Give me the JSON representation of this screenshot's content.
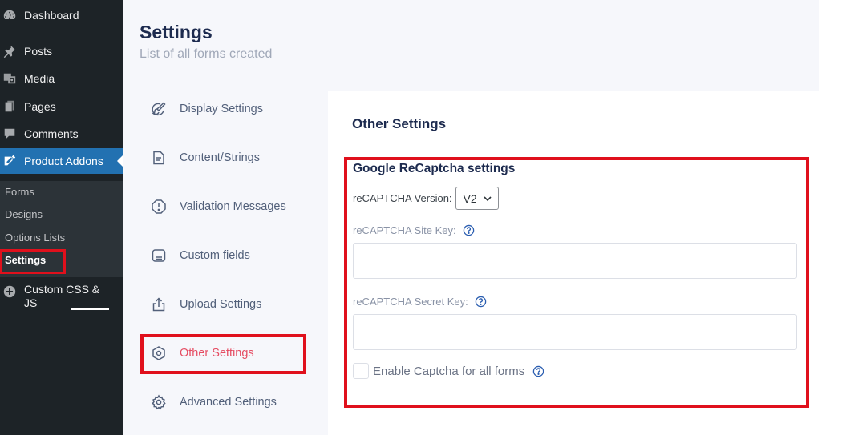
{
  "sidebar": {
    "items": [
      {
        "label": "Dashboard",
        "icon": "dashboard-icon"
      },
      {
        "label": "Posts",
        "icon": "pin-icon"
      },
      {
        "label": "Media",
        "icon": "media-icon"
      },
      {
        "label": "Pages",
        "icon": "pages-icon"
      },
      {
        "label": "Comments",
        "icon": "comments-icon"
      },
      {
        "label": "Product Addons",
        "icon": "product-addons-icon"
      },
      {
        "label": "Custom CSS &",
        "label2": "JS",
        "icon": "plus-circle-icon"
      }
    ],
    "submenu": [
      "Forms",
      "Designs",
      "Options Lists",
      "Settings"
    ],
    "active_submenu": "Settings"
  },
  "page": {
    "title": "Settings",
    "subtitle": "List of all forms created"
  },
  "settings_nav": [
    {
      "label": "Display Settings",
      "icon": "brush-icon"
    },
    {
      "label": "Content/Strings",
      "icon": "document-icon"
    },
    {
      "label": "Validation Messages",
      "icon": "alert-icon"
    },
    {
      "label": "Custom fields",
      "icon": "fields-icon"
    },
    {
      "label": "Upload Settings",
      "icon": "upload-icon"
    },
    {
      "label": "Other Settings",
      "icon": "hexagon-icon"
    },
    {
      "label": "Advanced Settings",
      "icon": "gear-icon"
    }
  ],
  "active_nav": "Other Settings",
  "panel": {
    "title": "Other Settings",
    "section_title": "Google ReCaptcha settings",
    "version_label": "reCAPTCHA Version:",
    "version_value": "V2",
    "site_key_label": "reCAPTCHA Site Key:",
    "site_key_value": "",
    "secret_key_label": "reCAPTCHA Secret Key:",
    "secret_key_value": "",
    "enable_label": "Enable Captcha for all forms",
    "enable_checked": false
  },
  "colors": {
    "sidebar_bg": "#1d2327",
    "accent": "#2271b1",
    "active_nav_text": "#e54c62",
    "highlight": "#e0101c"
  }
}
